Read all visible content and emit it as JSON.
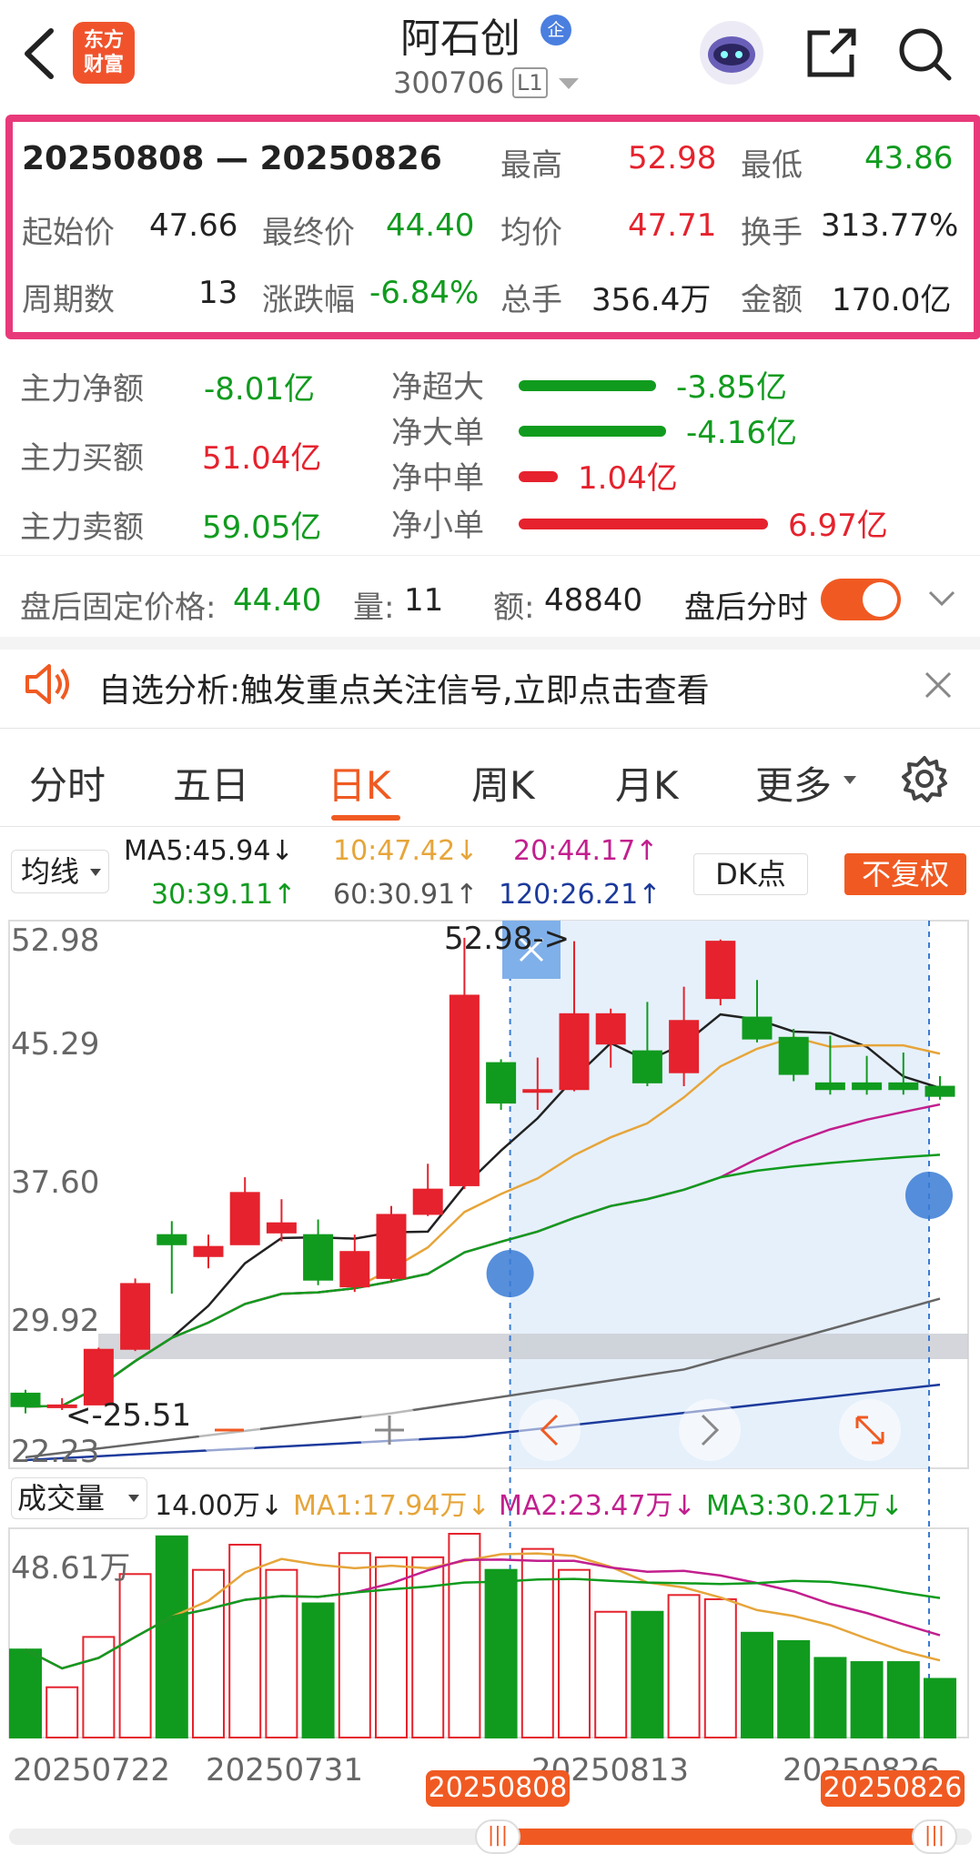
{
  "header": {
    "title": "阿石创",
    "title_badge": "企",
    "code": "300706",
    "level": "L1",
    "logo_line1": "东方",
    "logo_line2": "财富"
  },
  "stats": {
    "range": "20250808 — 20250826",
    "high_label": "最高",
    "high": "52.98",
    "low_label": "最低",
    "low": "43.86",
    "open_label": "起始价",
    "open": "47.66",
    "close_label": "最终价",
    "close": "44.40",
    "avg_label": "均价",
    "avg": "47.71",
    "turnover_label": "换手",
    "turnover": "313.77%",
    "periods_label": "周期数",
    "periods": "13",
    "change_label": "涨跌幅",
    "change": "-6.84%",
    "vol_label": "总手",
    "vol": "356.4万",
    "amount_label": "金额",
    "amount": "170.0亿"
  },
  "flows": {
    "main_net_label": "主力净额",
    "main_net": "-8.01亿",
    "main_buy_label": "主力买额",
    "main_buy": "51.04亿",
    "main_sell_label": "主力卖额",
    "main_sell": "59.05亿",
    "items": [
      {
        "label": "净超大",
        "value": "-3.85亿",
        "color": "#109b1e",
        "fill": 0.42
      },
      {
        "label": "净大单",
        "value": "-4.16亿",
        "color": "#109b1e",
        "fill": 0.45
      },
      {
        "label": "净中单",
        "value": "1.04亿",
        "color": "#e5222d",
        "fill": 0.12
      },
      {
        "label": "净小单",
        "value": "6.97亿",
        "color": "#e5222d",
        "fill": 0.76
      }
    ]
  },
  "afterhours": {
    "price_label": "盘后固定价格:",
    "price": "44.40",
    "vol_label": "量:",
    "vol": "11",
    "amt_label": "额:",
    "amt": "48840",
    "toggle_label": "盘后分时",
    "toggle_on": true
  },
  "notice": {
    "text": "自选分析:触发重点关注信号,立即点击查看"
  },
  "tabs": [
    "分时",
    "五日",
    "日K",
    "周K",
    "月K",
    "更多"
  ],
  "active_tab": "日K",
  "ma_row": {
    "selector": "均线",
    "ma5": "MA5:45.94↓",
    "ma10": "10:47.42↓",
    "ma20": "20:44.17↑",
    "ma30": "30:39.11↑",
    "ma60": "60:30.91↑",
    "ma120": "120:26.21↑",
    "dk": "DK点",
    "fq": "不复权"
  },
  "kline": {
    "y_labels": [
      "52.98",
      "45.29",
      "37.60",
      "29.92",
      "22.23"
    ],
    "max_marker": "52.98->",
    "min_marker": "<-25.51"
  },
  "volume": {
    "selector": "成交量",
    "v": "14.00万↓",
    "ma1": "MA1:17.94万↓",
    "ma2": "MA2:23.47万↓",
    "ma3": "MA3:30.21万↓",
    "y_label": "48.61万"
  },
  "dates": {
    "d1": "20250722",
    "d2": "20250731",
    "d3": "20250813",
    "d4": "20250826",
    "sel_start": "20250808",
    "sel_end": "20250826"
  },
  "chart_data": {
    "type": "candlestick",
    "dates": [
      "20250722",
      "20250723",
      "20250724",
      "20250725",
      "20250728",
      "20250729",
      "20250730",
      "20250731",
      "20250801",
      "20250804",
      "20250805",
      "20250806",
      "20250807",
      "20250808",
      "20250811",
      "20250812",
      "20250813",
      "20250814",
      "20250815",
      "20250818",
      "20250819",
      "20250820",
      "20250821",
      "20250822",
      "20250825",
      "20250826"
    ],
    "open": [
      26.2,
      25.4,
      25.5,
      28.8,
      35.6,
      34.3,
      35.0,
      35.7,
      35.6,
      32.5,
      33.0,
      36.8,
      38.5,
      45.8,
      44.2,
      44.2,
      46.9,
      46.5,
      45.2,
      49.6,
      48.5,
      47.3,
      44.6,
      44.6,
      44.6,
      44.4
    ],
    "close": [
      25.4,
      25.5,
      28.8,
      32.7,
      35.0,
      34.9,
      38.1,
      36.3,
      32.9,
      34.6,
      36.8,
      38.3,
      49.8,
      43.4,
      44.2,
      48.7,
      48.7,
      44.6,
      48.3,
      53.0,
      47.2,
      45.1,
      44.2,
      44.2,
      44.2,
      43.8
    ],
    "high": [
      26.4,
      25.9,
      28.9,
      33.0,
      36.4,
      35.6,
      39.0,
      37.7,
      36.5,
      35.6,
      37.3,
      39.8,
      53.2,
      46.0,
      46.1,
      53.0,
      49.0,
      49.4,
      50.3,
      53.1,
      50.7,
      47.8,
      47.4,
      46.2,
      46.4,
      45.0
    ],
    "low": [
      25.0,
      25.2,
      25.5,
      28.7,
      32.1,
      33.6,
      35.0,
      35.2,
      32.6,
      32.2,
      32.8,
      36.7,
      38.3,
      43.0,
      43.0,
      44.1,
      45.5,
      44.4,
      44.4,
      49.2,
      47.0,
      44.7,
      43.9,
      43.9,
      43.9,
      43.6
    ],
    "volume_wan": [
      21,
      12,
      24,
      39,
      48,
      40,
      46,
      40,
      32,
      44,
      43,
      43,
      48.61,
      40,
      45,
      40,
      30,
      30,
      34,
      33,
      25,
      23,
      19,
      18,
      18,
      14
    ],
    "ylim": [
      22.23,
      52.98
    ],
    "y_ticks": [
      52.98,
      45.29,
      37.6,
      29.92,
      22.23
    ]
  }
}
